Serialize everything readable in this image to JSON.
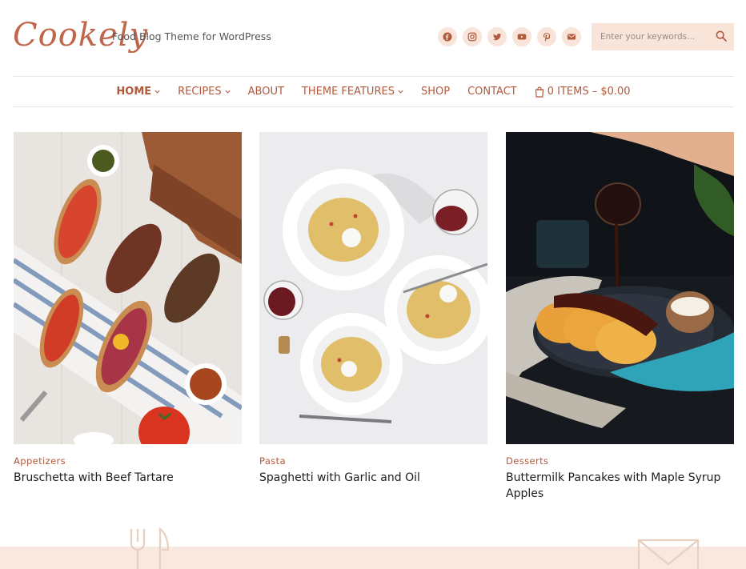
{
  "header": {
    "logo": "Cookely",
    "tagline": "Food Blog Theme for WordPress",
    "socials": [
      {
        "icon": "facebook-icon"
      },
      {
        "icon": "instagram-icon"
      },
      {
        "icon": "twitter-icon"
      },
      {
        "icon": "youtube-icon"
      },
      {
        "icon": "pinterest-icon"
      },
      {
        "icon": "email-icon"
      }
    ],
    "search_placeholder": "Enter your keywords..."
  },
  "nav": {
    "items": [
      {
        "label": "HOME",
        "dropdown": true,
        "active": true
      },
      {
        "label": "RECIPES",
        "dropdown": true
      },
      {
        "label": "ABOUT",
        "dropdown": false
      },
      {
        "label": "THEME FEATURES",
        "dropdown": true
      },
      {
        "label": "SHOP",
        "dropdown": false
      },
      {
        "label": "CONTACT",
        "dropdown": false
      }
    ],
    "cart": "0 ITEMS – $0.00"
  },
  "posts": [
    {
      "category": "Appetizers",
      "title": "Bruschetta with Beef Tartare"
    },
    {
      "category": "Pasta",
      "title": "Spaghetti with Garlic and Oil"
    },
    {
      "category": "Desserts",
      "title": "Buttermilk Pancakes with Maple Syrup Apples"
    }
  ],
  "colors": {
    "accent": "#b2593d",
    "soft": "#f8e4d9"
  }
}
